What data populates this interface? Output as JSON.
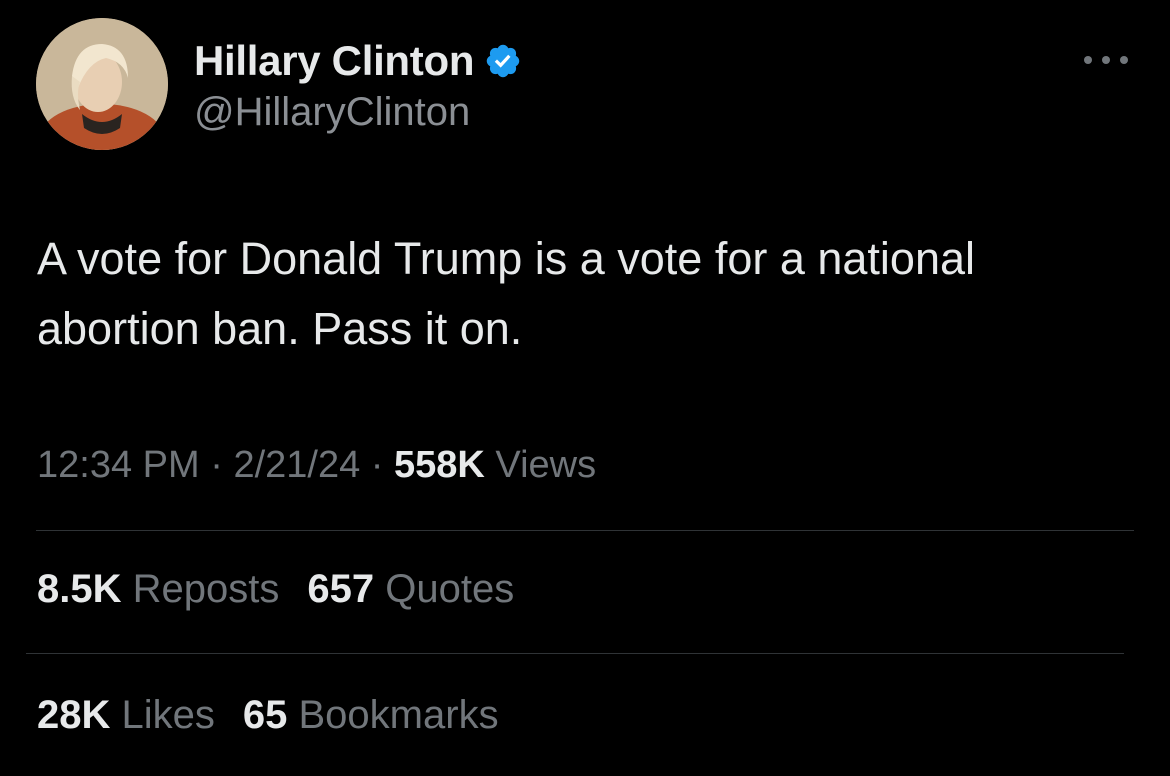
{
  "author": {
    "display_name": "Hillary Clinton",
    "handle": "@HillaryClinton",
    "verified_icon": "verified-badge-icon",
    "verified_color": "#1d9bf0"
  },
  "tweet": {
    "text": "A vote for Donald Trump is a vote for a national abortion ban. Pass it on."
  },
  "meta": {
    "time": "12:34 PM",
    "sep1": " · ",
    "date": "2/21/24",
    "sep2": " · ",
    "views_count": "558K",
    "views_label": " Views"
  },
  "stats": {
    "reposts": {
      "count": "8.5K",
      "label": " Reposts"
    },
    "quotes": {
      "count": "657",
      "label": " Quotes"
    },
    "likes": {
      "count": "28K",
      "label": " Likes"
    },
    "bookmarks": {
      "count": "65",
      "label": " Bookmarks"
    }
  },
  "colors": {
    "background": "#000000",
    "primary_text": "#e7e9ea",
    "secondary_text": "#71767b",
    "divider": "#2f3336"
  }
}
